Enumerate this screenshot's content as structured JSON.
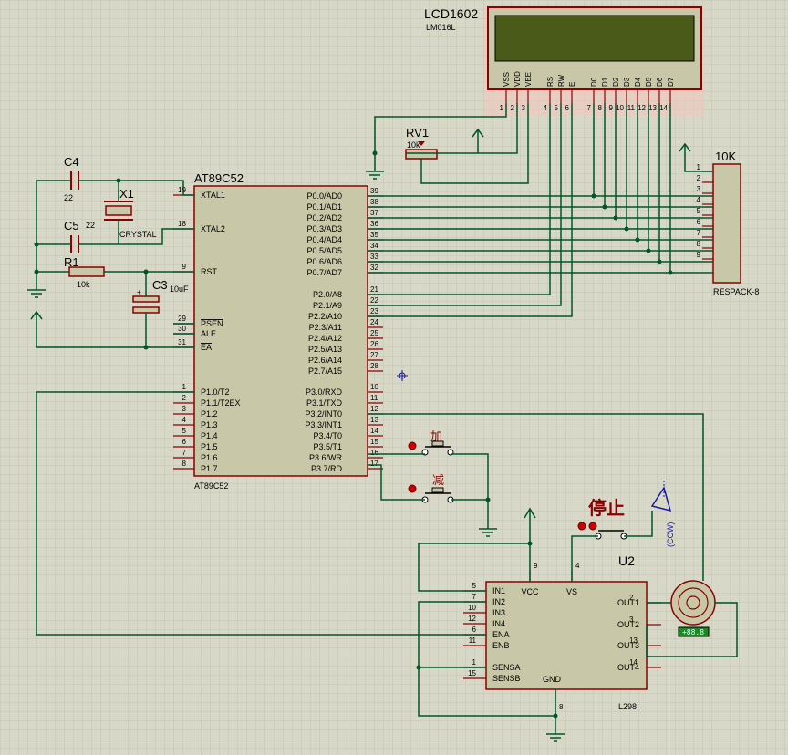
{
  "lcd": {
    "ref": "LCD1602",
    "model": "LM016L",
    "pin_names": [
      "VSS",
      "VDD",
      "VEE",
      "RS",
      "RW",
      "E",
      "D0",
      "D1",
      "D2",
      "D3",
      "D4",
      "D5",
      "D6",
      "D7"
    ],
    "pin_numbers": [
      "1",
      "2",
      "3",
      "4",
      "5",
      "6",
      "7",
      "8",
      "9",
      "10",
      "11",
      "12",
      "13",
      "14"
    ]
  },
  "rv1": {
    "ref": "RV1",
    "value": "10k"
  },
  "resistor_pack": {
    "value": "10K",
    "model": "RESPACK-8",
    "pins": [
      "1",
      "2",
      "3",
      "4",
      "5",
      "6",
      "7",
      "8",
      "9"
    ]
  },
  "mcu": {
    "ref": "AT89C52",
    "model": "AT89C52",
    "left_pins": [
      {
        "num": "19",
        "name": "XTAL1"
      },
      {
        "num": "18",
        "name": "XTAL2"
      },
      {
        "num": "9",
        "name": "RST"
      },
      {
        "num": "29",
        "name": "PSEN"
      },
      {
        "num": "30",
        "name": "ALE"
      },
      {
        "num": "31",
        "name": "EA"
      },
      {
        "num": "1",
        "name": "P1.0/T2"
      },
      {
        "num": "2",
        "name": "P1.1/T2EX"
      },
      {
        "num": "3",
        "name": "P1.2"
      },
      {
        "num": "4",
        "name": "P1.3"
      },
      {
        "num": "5",
        "name": "P1.4"
      },
      {
        "num": "6",
        "name": "P1.5"
      },
      {
        "num": "7",
        "name": "P1.6"
      },
      {
        "num": "8",
        "name": "P1.7"
      }
    ],
    "right_pins": [
      {
        "num": "39",
        "name": "P0.0/AD0"
      },
      {
        "num": "38",
        "name": "P0.1/AD1"
      },
      {
        "num": "37",
        "name": "P0.2/AD2"
      },
      {
        "num": "36",
        "name": "P0.3/AD3"
      },
      {
        "num": "35",
        "name": "P0.4/AD4"
      },
      {
        "num": "34",
        "name": "P0.5/AD5"
      },
      {
        "num": "33",
        "name": "P0.6/AD6"
      },
      {
        "num": "32",
        "name": "P0.7/AD7"
      },
      {
        "num": "21",
        "name": "P2.0/A8"
      },
      {
        "num": "22",
        "name": "P2.1/A9"
      },
      {
        "num": "23",
        "name": "P2.2/A10"
      },
      {
        "num": "24",
        "name": "P2.3/A11"
      },
      {
        "num": "25",
        "name": "P2.4/A12"
      },
      {
        "num": "26",
        "name": "P2.5/A13"
      },
      {
        "num": "27",
        "name": "P2.6/A14"
      },
      {
        "num": "28",
        "name": "P2.7/A15"
      },
      {
        "num": "10",
        "name": "P3.0/RXD"
      },
      {
        "num": "11",
        "name": "P3.1/TXD"
      },
      {
        "num": "12",
        "name": "P3.2/INT0"
      },
      {
        "num": "13",
        "name": "P3.3/INT1"
      },
      {
        "num": "14",
        "name": "P3.4/T0"
      },
      {
        "num": "15",
        "name": "P3.5/T1"
      },
      {
        "num": "16",
        "name": "P3.6/WR"
      },
      {
        "num": "17",
        "name": "P3.7/RD"
      }
    ]
  },
  "c4": {
    "ref": "C4",
    "value": "22"
  },
  "c5": {
    "ref": "C5",
    "value": "22"
  },
  "x1": {
    "ref": "X1",
    "value": "CRYSTAL"
  },
  "r1": {
    "ref": "R1",
    "value": "10k"
  },
  "c3": {
    "ref": "C3",
    "value": "10uF"
  },
  "buttons": {
    "up": "加",
    "down": "减",
    "stop": "停止"
  },
  "motor": {
    "direction": "(CCW)",
    "readout": "+88.8"
  },
  "l298": {
    "ref": "U2",
    "model": "L298",
    "left_pins": [
      {
        "num": "5",
        "name": "IN1"
      },
      {
        "num": "7",
        "name": "IN2"
      },
      {
        "num": "10",
        "name": "IN3"
      },
      {
        "num": "12",
        "name": "IN4"
      },
      {
        "num": "6",
        "name": "ENA"
      },
      {
        "num": "11",
        "name": "ENB"
      },
      {
        "num": "1",
        "name": "SENSA"
      },
      {
        "num": "15",
        "name": "SENSB"
      }
    ],
    "right_pins": [
      {
        "num": "2",
        "name": "OUT1"
      },
      {
        "num": "3",
        "name": "OUT2"
      },
      {
        "num": "13",
        "name": "OUT3"
      },
      {
        "num": "14",
        "name": "OUT4"
      }
    ],
    "top_pins": [
      {
        "num": "9",
        "name": "VCC"
      },
      {
        "num": "4",
        "name": "VS"
      }
    ],
    "bottom_pin": {
      "num": "8",
      "name": "GND"
    }
  },
  "colors": {
    "background": "#d8d8c8",
    "grid": "#c4c4b2",
    "wire": "#00552b",
    "part_outline": "#8b0000",
    "part_fill": "#c8c8a8",
    "lcd_screen": "#4a5a18",
    "pin_text": "#000000",
    "label_text": "#000000",
    "probe": "#1a1aa0"
  }
}
